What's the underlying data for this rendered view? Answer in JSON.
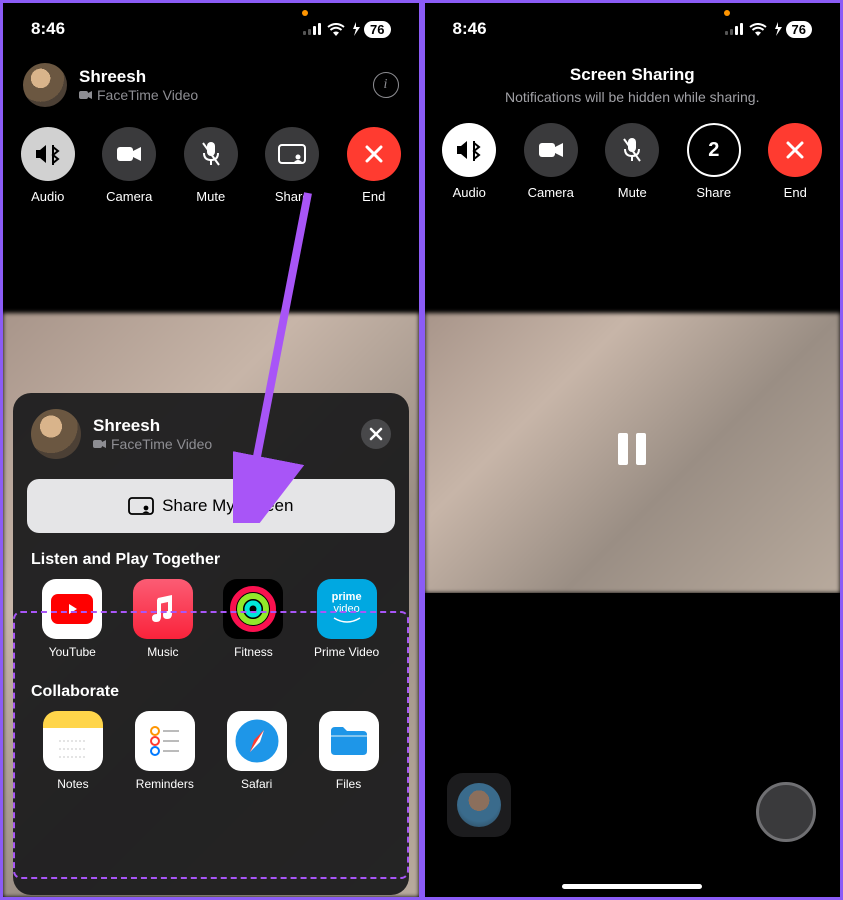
{
  "left": {
    "status": {
      "time": "8:46",
      "battery": "76"
    },
    "caller": {
      "name": "Shreesh",
      "sub": "FaceTime Video"
    },
    "controls": {
      "audio": "Audio",
      "camera": "Camera",
      "mute": "Mute",
      "share": "Share",
      "end": "End"
    },
    "sheet": {
      "name": "Shreesh",
      "sub": "FaceTime Video",
      "share_btn": "Share My Screen",
      "listen_title": "Listen and Play Together",
      "collab_title": "Collaborate",
      "apps1": [
        "YouTube",
        "Music",
        "Fitness",
        "Prime Video"
      ],
      "apps2": [
        "Notes",
        "Reminders",
        "Safari",
        "Files"
      ]
    }
  },
  "right": {
    "status": {
      "time": "8:46",
      "battery": "76"
    },
    "share_hdr_title": "Screen Sharing",
    "share_hdr_sub": "Notifications will be hidden while sharing.",
    "controls": {
      "audio": "Audio",
      "camera": "Camera",
      "mute": "Mute",
      "share": "Share",
      "share_count": "2",
      "end": "End"
    }
  }
}
